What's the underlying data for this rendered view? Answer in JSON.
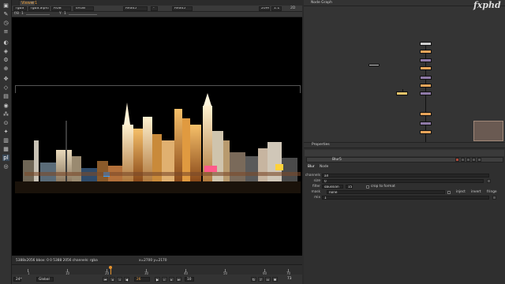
{
  "viewer": {
    "tab": "Viewer1",
    "channels": "rgba",
    "channel_layer": "rgba.alpha",
    "colorspace": "RGB",
    "lut": "sRGB",
    "input_a": "Read5",
    "input_b": "Read5",
    "proxy": "2096",
    "zoom": "1:1",
    "mode": "2D",
    "gain_label": "f/8",
    "gain_value": "1",
    "gamma_label": "Y",
    "gamma_value": "1",
    "status_left": "5388x2056  bbox: 0 0 5388 2056 channels: rgba",
    "status_right": "x=2700 y=2170"
  },
  "timeline": {
    "ticks": [
      "1",
      "10",
      "20",
      "30",
      "40",
      "50",
      "60",
      "70"
    ],
    "fps": "24*",
    "global": "Global",
    "frame": "26",
    "increment": "10",
    "end_frame": "73"
  },
  "node_graph": {
    "tab": "Node Graph",
    "logo": "fxphd"
  },
  "properties": {
    "tab": "Properties",
    "node_name": "Blur5",
    "tabs": [
      "Blur",
      "Node"
    ],
    "channels_label": "channels",
    "channels_value": "all",
    "size_label": "size",
    "size_value": "0",
    "filter_label": "filter",
    "filter_value": "gaussian",
    "quality_value": "15",
    "crop_label": "crop to format",
    "mask_label": "mask",
    "mask_value": "none",
    "inject_label": "inject",
    "invert_label": "invert",
    "fringe_label": "fringe",
    "mix_label": "mix",
    "mix_value": "1"
  }
}
